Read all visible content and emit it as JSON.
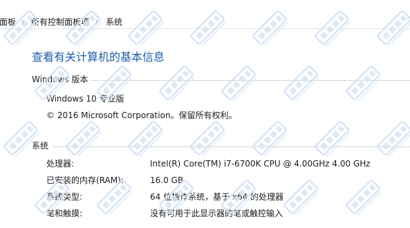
{
  "breadcrumb": {
    "items": [
      "面板",
      "所有控制面板项",
      "系统"
    ],
    "separator": "›"
  },
  "page_title": "查看有关计算机的基本信息",
  "edition_section": {
    "title": "Windows 版本",
    "edition": "Windows 10 专业版",
    "copyright": "© 2016 Microsoft Corporation。保留所有权利。"
  },
  "system_section": {
    "title": "系统",
    "rows": [
      {
        "label": "处理器:",
        "value": "Intel(R) Core(TM) i7-6700K CPU @ 4.00GHz   4.00 GHz"
      },
      {
        "label": "已安装的内存(RAM):",
        "value": "16.0 GB"
      },
      {
        "label": "系统类型:",
        "value": "64 位操作系统，基于 x64 的处理器"
      },
      {
        "label": "笔和触摸:",
        "value": "没有可用于此显示器的笔或触控输入"
      }
    ]
  },
  "colors": {
    "title_blue": "#1e5fa8",
    "watermark_blue": "#cfe0f2"
  }
}
